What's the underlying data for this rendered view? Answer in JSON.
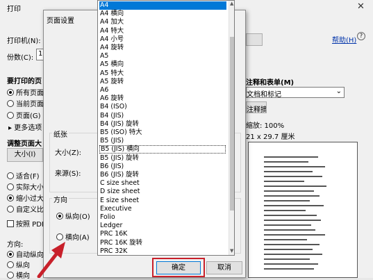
{
  "print_dialog": {
    "title": "打印",
    "close_glyph": "✕",
    "printer_label": "打印机(N):",
    "copies_label": "份数(C):",
    "copies_value": "1",
    "help_link": "帮助(H)",
    "pages_heading": "要打印的页",
    "pages_options": [
      "所有页面",
      "当前页面",
      "页面(G)"
    ],
    "more_options": "▸ 更多选项",
    "annot_heading": "注释和表单(M)",
    "annot_value": "文档和标记",
    "annot_summary_btn": "注释摘要(Y)",
    "scale_label": "缩放: 100%",
    "size_label": "21 x 29.7 厘米",
    "adjust_heading": "调整页面大",
    "size_btn": "大小(I)",
    "size_options": [
      "适合(F)",
      "实际大小",
      "缩小过大",
      "自定义比"
    ],
    "print_pdf": "按照 PDF",
    "orientation_heading": "方向:",
    "orientation_options": [
      "自动纵向",
      "纵向",
      "横向"
    ]
  },
  "setup_dialog": {
    "title": "页面设置",
    "paper_group": "纸张",
    "size_label": "大小(Z):",
    "source_label": "来源(S):",
    "orientation_group": "方向",
    "portrait": "纵向(O)",
    "landscape": "横向(A)",
    "ok_button": "确定",
    "cancel_button": "取消"
  },
  "paper_list": {
    "selected": "A4",
    "focused": "B5 (JIS) 横向",
    "items": [
      "A4",
      "A4 横向",
      "A4 加大",
      "A4 特大",
      "A4 小号",
      "A4 旋转",
      "A5",
      "A5 横向",
      "A5 特大",
      "A5 旋转",
      "A6",
      "A6 旋转",
      "B4 (ISO)",
      "B4 (JIS)",
      "B4 (JIS) 旋转",
      "B5 (ISO) 特大",
      "B5 (JIS)",
      "B5 (JIS) 横向",
      "B5 (JIS) 旋转",
      "B6 (JIS)",
      "B6 (JIS) 旋转",
      "C size sheet",
      "D size sheet",
      "E size sheet",
      "Executive",
      "Folio",
      "Ledger",
      "PRC 16K",
      "PRC 16K 旋转",
      "PRC 32K"
    ]
  },
  "colors": {
    "accent": "#0078d7",
    "arrow": "#c8202a",
    "highlight_box": "#c8202a"
  }
}
